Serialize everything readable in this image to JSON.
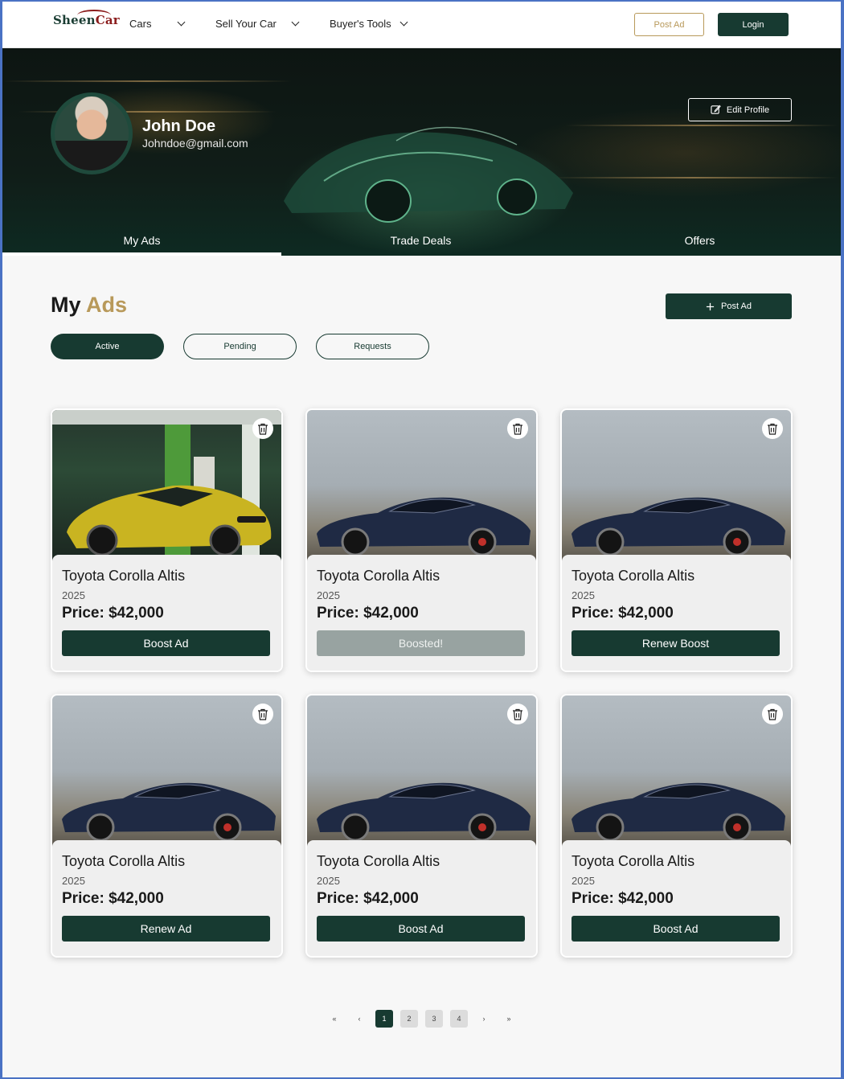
{
  "nav": {
    "logo_part1": "Sheen",
    "logo_part2": "Car",
    "items": [
      {
        "label": "Cars"
      },
      {
        "label": "Sell Your Car"
      },
      {
        "label": "Buyer's Tools"
      }
    ],
    "post_ad": "Post Ad",
    "login": "Login"
  },
  "profile": {
    "name": "John Doe",
    "email": "Johndoe@gmail.com",
    "edit_profile": "Edit Profile"
  },
  "tabs": [
    {
      "label": "My Ads",
      "active": true
    },
    {
      "label": "Trade Deals",
      "active": false
    },
    {
      "label": "Offers",
      "active": false
    }
  ],
  "main": {
    "title_part1": "My",
    "title_part2": "Ads",
    "post_ad": "Post Ad",
    "filters": [
      {
        "label": "Active",
        "active": true
      },
      {
        "label": "Pending",
        "active": false
      },
      {
        "label": "Requests",
        "active": false
      }
    ]
  },
  "cards": [
    {
      "title": "Toyota Corolla Altis",
      "year": "2025",
      "price": "Price: $42,000",
      "button": "Boost Ad",
      "button_state": "enabled",
      "image": "yellow-sedan-gas-station"
    },
    {
      "title": "Toyota Corolla Altis",
      "year": "2025",
      "price": "Price: $42,000",
      "button": "Boosted!",
      "button_state": "disabled",
      "image": "dark-blue-coupe"
    },
    {
      "title": "Toyota Corolla Altis",
      "year": "2025",
      "price": "Price: $42,000",
      "button": "Renew Boost",
      "button_state": "enabled",
      "image": "dark-blue-coupe"
    },
    {
      "title": "Toyota Corolla Altis",
      "year": "2025",
      "price": "Price: $42,000",
      "button": "Renew Ad",
      "button_state": "enabled",
      "image": "dark-blue-coupe"
    },
    {
      "title": "Toyota Corolla Altis",
      "year": "2025",
      "price": "Price: $42,000",
      "button": "Boost Ad",
      "button_state": "enabled",
      "image": "dark-blue-coupe"
    },
    {
      "title": "Toyota Corolla Altis",
      "year": "2025",
      "price": "Price: $42,000",
      "button": "Boost Ad",
      "button_state": "enabled",
      "image": "dark-blue-coupe"
    }
  ],
  "pagination": {
    "first": "«",
    "prev": "‹",
    "pages": [
      "1",
      "2",
      "3",
      "4"
    ],
    "current": "1",
    "next": "›",
    "last": "»"
  },
  "colors": {
    "brand_dark_green": "#173a31",
    "accent_gold": "#b8995a",
    "logo_red": "#8b1d1d",
    "disabled_button": "#98a3a1"
  }
}
